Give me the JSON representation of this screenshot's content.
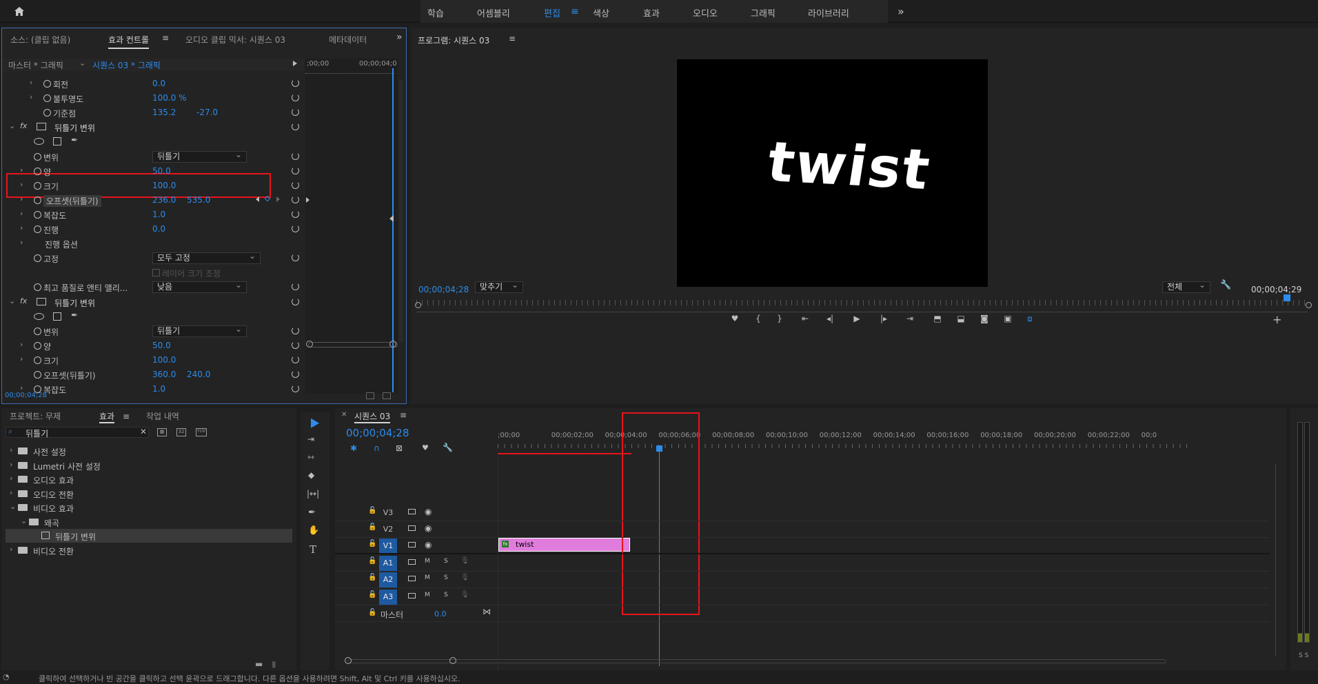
{
  "workspace_tabs": [
    "학습",
    "어셈블리",
    "편집",
    "색상",
    "효과",
    "오디오",
    "그래픽",
    "라이브러리"
  ],
  "workspace_active": "편집",
  "more_icon": "»",
  "source_panel": {
    "tabs": [
      "소스: (클립 없음)",
      "효과 컨트롤",
      "오디오 클립 믹서: 시퀀스 03",
      "메타데이터"
    ],
    "master_label": "마스터 * 그래픽",
    "clip_label": "시퀀스 03 * 그래픽",
    "time_start": ";00;00",
    "time_end": "00;00;04;0",
    "timecode": "00;00;04;28",
    "rows": [
      {
        "label": "회전",
        "v1": "0.0",
        "v2": ""
      },
      {
        "label": "불투명도",
        "v1": "100.0 %",
        "v2": ""
      },
      {
        "label": "기준점",
        "v1": "135.2",
        "v2": "-27.0"
      },
      {
        "label": "뒤틀기 변위",
        "v1": "",
        "v2": ""
      },
      {
        "label": "",
        "v1": "",
        "v2": ""
      },
      {
        "label": "변위",
        "v1": "뒤틀기",
        "v2": ""
      },
      {
        "label": "양",
        "v1": "50.0",
        "v2": ""
      },
      {
        "label": "크기",
        "v1": "100.0",
        "v2": ""
      },
      {
        "label": "오프셋(뒤틀기)",
        "v1": "236.0",
        "v2": "535.0"
      },
      {
        "label": "복잡도",
        "v1": "1.0",
        "v2": ""
      },
      {
        "label": "진행",
        "v1": "0.0",
        "v2": ""
      },
      {
        "label": "진행 옵션",
        "v1": "",
        "v2": ""
      },
      {
        "label": "고정",
        "v1": "모두 고정",
        "v2": ""
      },
      {
        "label": "레이어 크기 조정",
        "v1": "",
        "v2": ""
      },
      {
        "label": "최고 품질로 앤티 앨리...",
        "v1": "낮음",
        "v2": ""
      },
      {
        "label": "뒤틀기 변위",
        "v1": "",
        "v2": ""
      },
      {
        "label": "",
        "v1": "",
        "v2": ""
      },
      {
        "label": "변위",
        "v1": "뒤틀기",
        "v2": ""
      },
      {
        "label": "양",
        "v1": "50.0",
        "v2": ""
      },
      {
        "label": "크기",
        "v1": "100.0",
        "v2": ""
      },
      {
        "label": "오프셋(뒤틀기)",
        "v1": "360.0",
        "v2": "240.0"
      },
      {
        "label": "복잡도",
        "v1": "1.0",
        "v2": ""
      }
    ]
  },
  "program_panel": {
    "title": "프로그램: 시퀀스 03",
    "video_text": "twist",
    "timecode_left": "00;00;04;28",
    "fit_label": "맞추기",
    "quality_label": "전체",
    "timecode_right": "00;00;04;29"
  },
  "project_panel": {
    "tabs": [
      "프로젝트: 무제",
      "효과",
      "작업 내역"
    ],
    "search_value": "뒤틀기",
    "items": [
      {
        "label": "사전 설정",
        "indent": 0,
        "open": false
      },
      {
        "label": "Lumetri 사전 설정",
        "indent": 0,
        "open": false
      },
      {
        "label": "오디오 효과",
        "indent": 0,
        "open": false
      },
      {
        "label": "오디오 전환",
        "indent": 0,
        "open": false
      },
      {
        "label": "비디오 효과",
        "indent": 0,
        "open": true
      },
      {
        "label": "왜곡",
        "indent": 1,
        "open": true
      },
      {
        "label": "뒤틀기 변위",
        "indent": 2,
        "open": false
      },
      {
        "label": "비디오 전환",
        "indent": 0,
        "open": false
      }
    ]
  },
  "timeline": {
    "title": "시퀀스 03",
    "timecode": "00;00;04;28",
    "ruler": [
      ";00;00",
      "00;00;02;00",
      "00;00;04;00",
      "00;00;06;00",
      "00;00;08;00",
      "00;00;10;00",
      "00;00;12;00",
      "00;00;14;00",
      "00;00;16;00",
      "00;00;18;00",
      "00;00;20;00",
      "00;00;22;00",
      "00;0"
    ],
    "tracks": [
      "V3",
      "V2",
      "V1",
      "A1",
      "A2",
      "A3"
    ],
    "master_label": "마스터",
    "master_value": "0.0",
    "clip_label": "twist",
    "m_label": "M",
    "s_label": "S"
  },
  "meter_labels": "S S",
  "status_text": "클릭하여 선택하거나 빈 공간을 클릭하고 선택 윤곽으로 드래그합니다. 다른 옵션을 사용하려면 Shift, Alt 및 Ctrl 키를 사용하십시오.",
  "colors": {
    "accent": "#2d8ceb",
    "highlight": "#e8141c",
    "clip": "#e07ddc",
    "track_active": "#1e5aa0"
  }
}
